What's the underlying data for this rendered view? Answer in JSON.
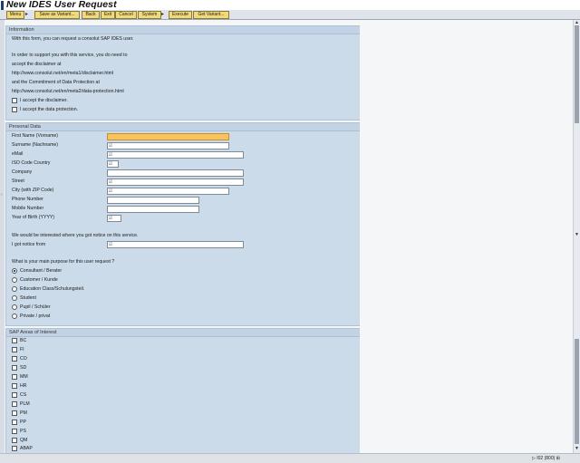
{
  "title": "New IDES User Request",
  "toolbar": {
    "menu": "Menu",
    "save_as_variant": "Save as Variant...",
    "back": "Back",
    "exit": "Exit",
    "cancel": "Cancel",
    "system": "System",
    "execute": "Execute",
    "get_variant": "Get Variant..."
  },
  "information": {
    "header": "Information",
    "lines": [
      "With this form, you can request a consolut SAP IDES user.",
      "In order to support you with this service, you do need to",
      "accept the disclaimer at",
      "http://www.consolut.net/en/meta1/disclaimer.html",
      "and the Commitment of Data Protection at",
      "http://www.consolut.net/en/meta2/data-protection.html"
    ],
    "checkboxes": [
      "I accept the disclaimer.",
      "I accept the data protection."
    ]
  },
  "personal": {
    "header": "Personal Data",
    "fields": [
      {
        "label": "First Name (Vorname)",
        "value": ""
      },
      {
        "label": "Surname (Nachname)",
        "value": "☑"
      },
      {
        "label": "eMail",
        "value": "☑"
      },
      {
        "label": "ISO Code Country",
        "value": "☑"
      },
      {
        "label": "Company",
        "value": ""
      },
      {
        "label": "Street",
        "value": "☑"
      },
      {
        "label": "City (with ZIP Code)",
        "value": "☑"
      },
      {
        "label": "Phone Number",
        "value": ""
      },
      {
        "label": "Mobile Number",
        "value": ""
      },
      {
        "label": "Year of Birth (YYYY)",
        "value": "☑"
      }
    ],
    "notice_text": "We would be interested where you got notice on this service.",
    "notice_label": "I got notice from",
    "notice_value": "☑",
    "purpose_question": "What is your main purpose for this user request ?",
    "purposes": [
      "Consultant / Berater",
      "Customer / Kunde",
      "Education Class/Schulungsteil.",
      "Student",
      "Pupil / Schüler",
      "Private / privat"
    ],
    "selected_purpose": 0
  },
  "areas": {
    "header": "SAP Areas of Interest",
    "items": [
      "BC",
      "FI",
      "CO",
      "SD",
      "MM",
      "HR",
      "CS",
      "PLM",
      "PM",
      "PP",
      "PS",
      "QM",
      "ABAP"
    ]
  },
  "status": {
    "text": "I02 (800)"
  },
  "colors": {
    "panel": "#cbdbe9",
    "required_field": "#f7c35a",
    "button": "#f2d97a",
    "title_accent": "#1c3f6e"
  }
}
